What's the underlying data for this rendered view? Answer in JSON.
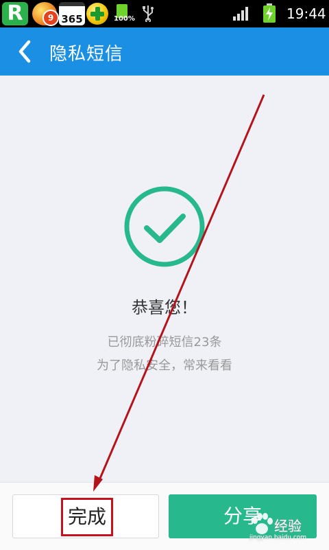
{
  "status_bar": {
    "time": "19:44",
    "battery_percent_label": "100%",
    "app_icons": [
      "r-app-icon",
      "ball-app-icon",
      "calendar-365-icon",
      "plus-app-icon"
    ],
    "notification_badge": "9",
    "calendar_label": "365"
  },
  "header": {
    "title": "隐私短信",
    "back_icon": "back-chevron-icon"
  },
  "result": {
    "icon": "check-circle-icon",
    "headline": "恭喜您！",
    "line1": "已彻底粉碎短信23条",
    "line2": "为了隐私安全，常来看看"
  },
  "actions": {
    "done_label": "完成",
    "share_label": "分享"
  },
  "watermark": {
    "text": "经验",
    "url": "jingyan.baidu.com"
  },
  "colors": {
    "header_bg": "#1a8fe3",
    "accent_green": "#27b88e",
    "annotation_red": "#b3141c"
  }
}
